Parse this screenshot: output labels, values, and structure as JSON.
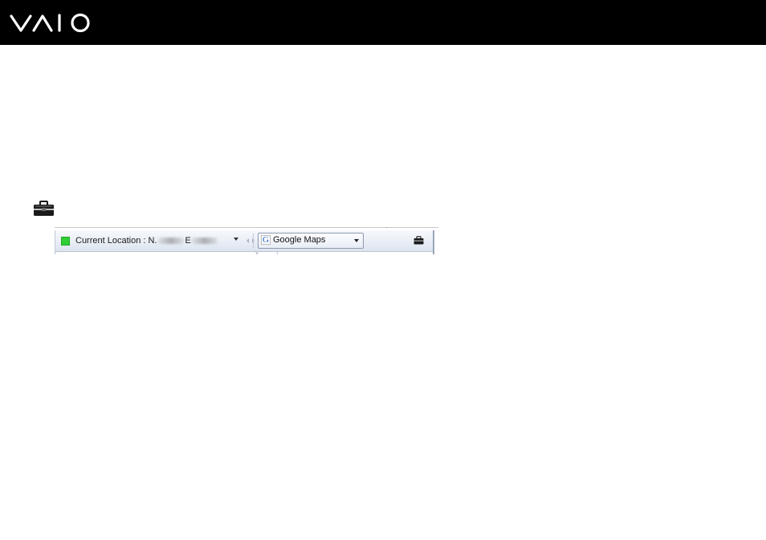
{
  "header": {
    "logo_name": "vaio-logo",
    "background": "#000000"
  },
  "toolbar": {
    "status_color": "#2fce34",
    "location_label": "Current Location : N.",
    "east_label": "E",
    "location_value_obscured": true,
    "map_service": {
      "selected": "Google Maps",
      "icon": "google-g-icon"
    },
    "icons": {
      "nav": "nav-arrows-icon",
      "toolbox": "toolbox-icon"
    }
  }
}
